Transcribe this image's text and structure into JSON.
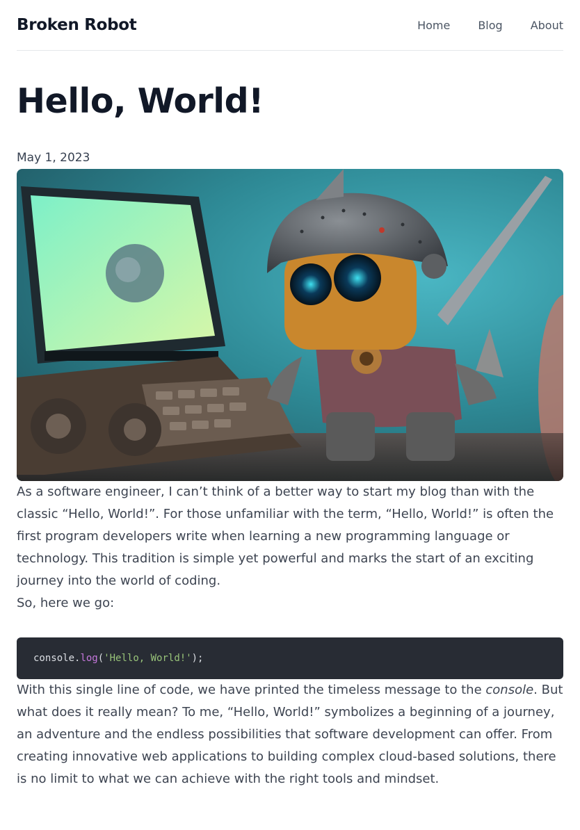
{
  "site": {
    "brand": "Broken Robot"
  },
  "nav": {
    "items": [
      "Home",
      "Blog",
      "About"
    ]
  },
  "post": {
    "title": "Hello, World!",
    "date": "May 1, 2023",
    "hero_image": "robot-at-computer-illustration",
    "paragraph_1": "As a software engineer, I can’t think of a better way to start my blog than with the classic “Hello, World!”. For those unfamiliar with the term, “Hello, World!” is often the first program developers write when learning a new programming language or technology. This tradition is simple yet powerful and marks the start of an exciting journey into the world of coding.",
    "paragraph_2": "So, here we go:",
    "code": {
      "object": "console",
      "dot": ".",
      "method": "log",
      "open": "(",
      "string": "'Hello, World!'",
      "close": ");"
    },
    "paragraph_3": {
      "before": "With this single line of code, we have printed the timeless message to the ",
      "emphasis": "console",
      "after": ". But what does it really mean? To me, “Hello, World!” symbolizes a beginning of a journey, an adventure and the endless possibilities that software development can offer. From creating innovative web applications to building complex cloud-based solutions, there is no limit to what we can achieve with the right tools and mindset."
    }
  },
  "colors": {
    "code_background": "#282c34",
    "code_method": "#c678dd",
    "code_string": "#98c379",
    "heading": "#111827"
  }
}
